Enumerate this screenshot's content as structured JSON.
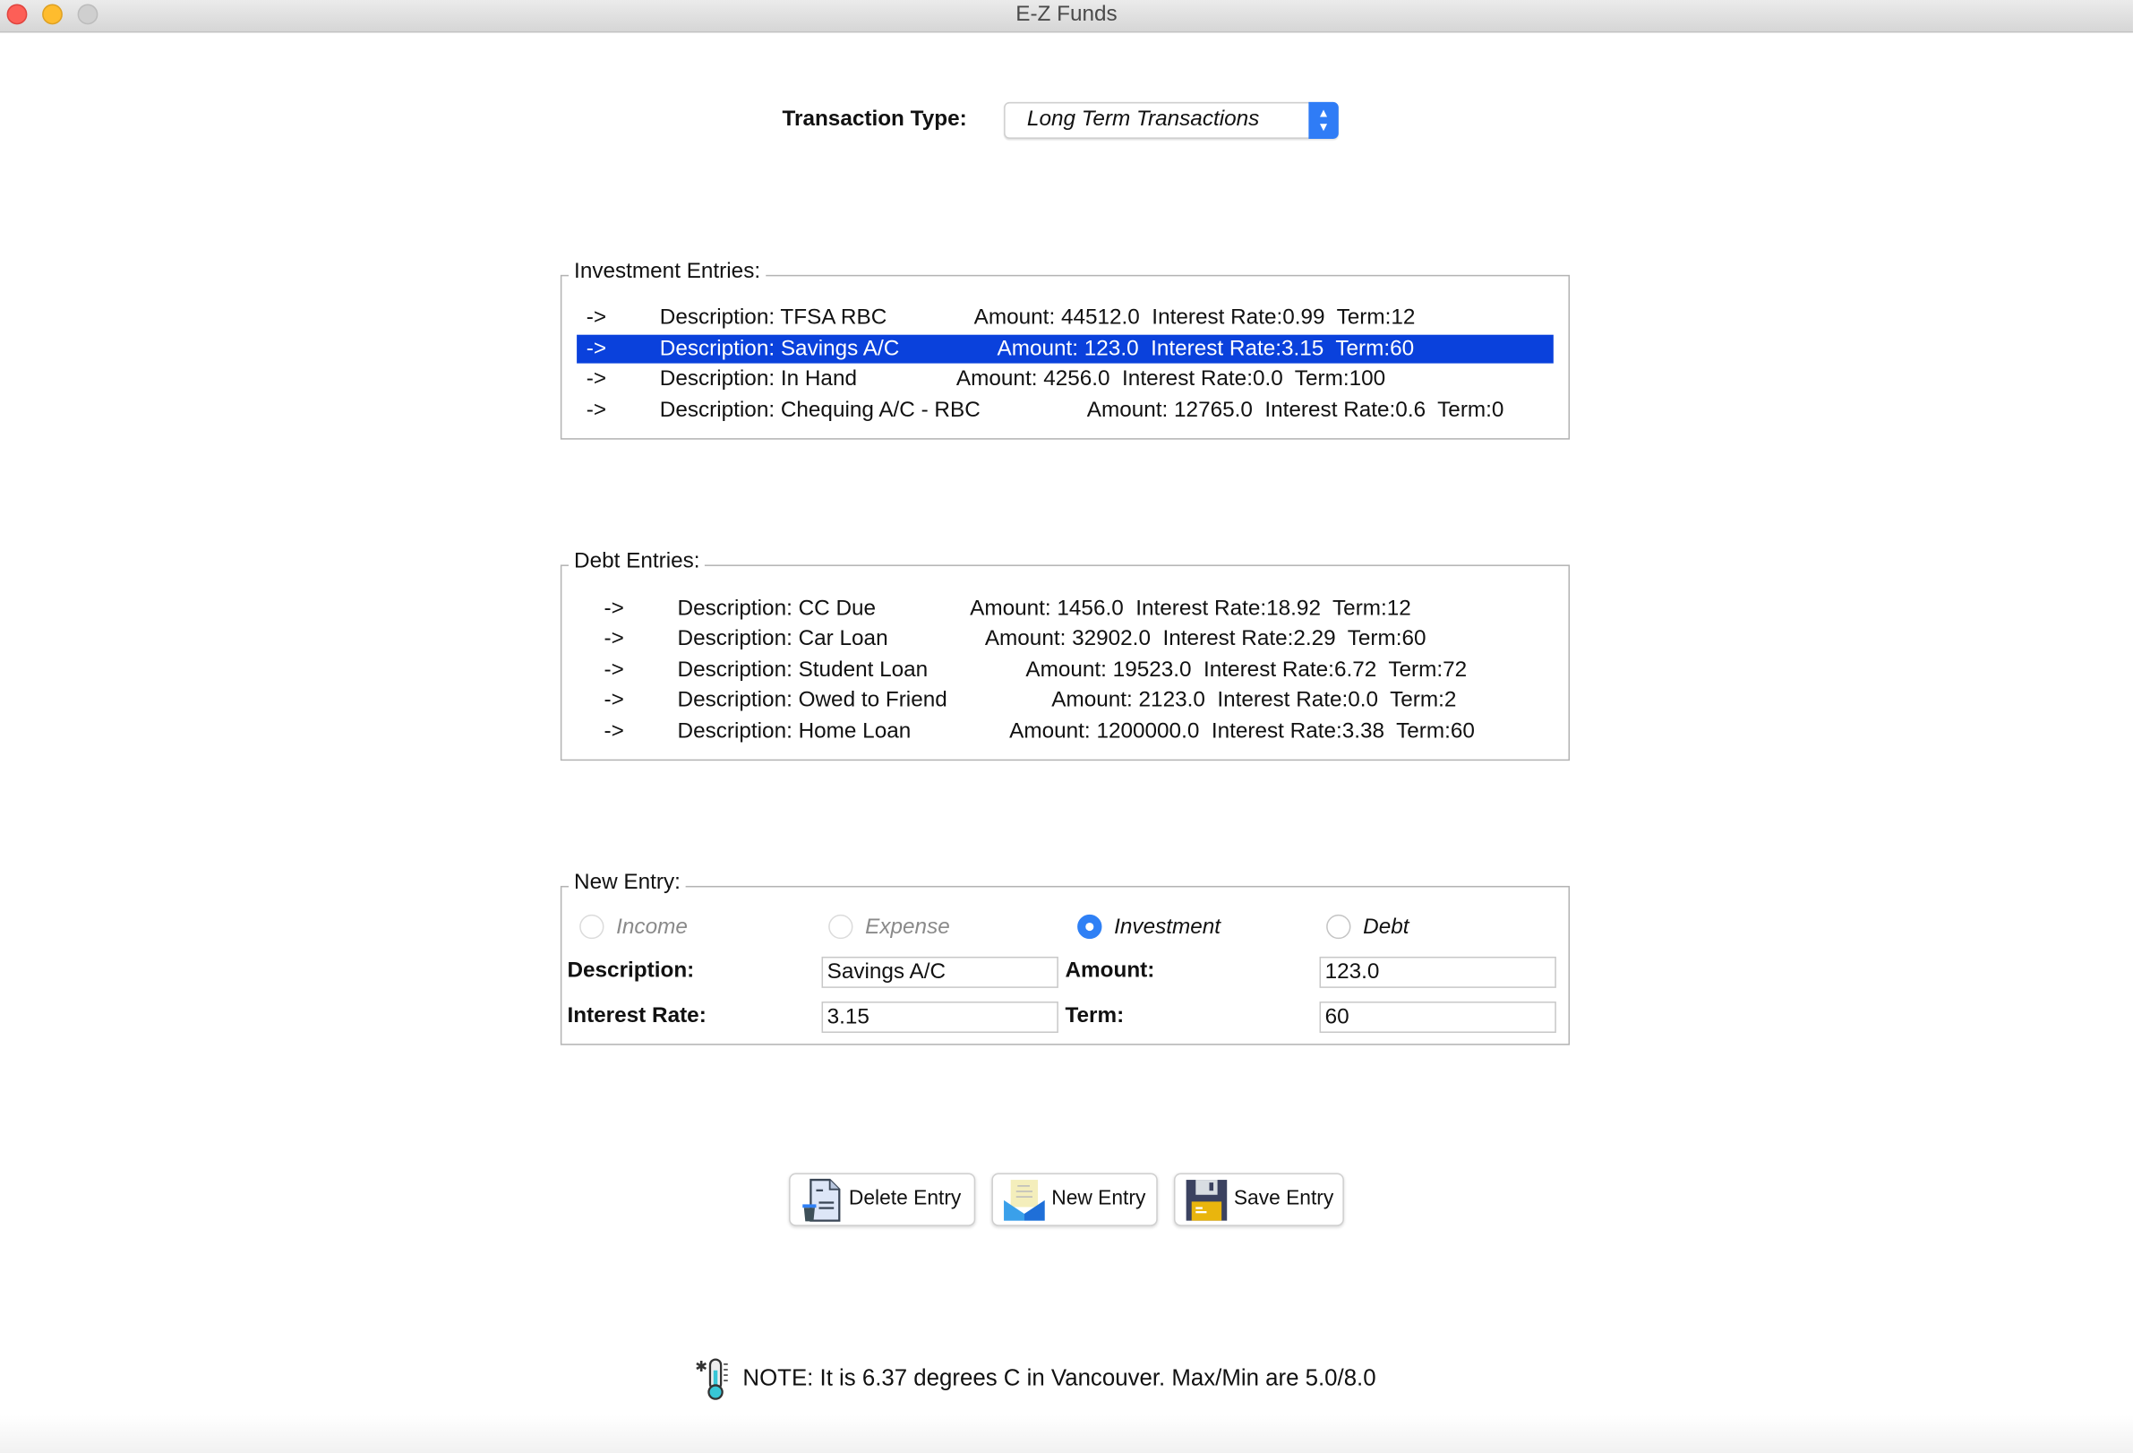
{
  "window": {
    "title": "E-Z Funds",
    "colors": {
      "close": "#fd5f57",
      "minimize": "#febc2e",
      "zoom": "#cfcfcf"
    }
  },
  "transaction_type": {
    "label": "Transaction Type:",
    "selected": "Long Term Transactions"
  },
  "investment": {
    "title": "Investment Entries:",
    "selected_index": 1,
    "selection_color": "#0a41dc",
    "rows": [
      {
        "arrow": "->",
        "description": "Description: TFSA RBC",
        "details": "Amount: 44512.0  Interest Rate:0.99  Term:12"
      },
      {
        "arrow": "->",
        "description": "Description: Savings A/C",
        "details": "Amount: 123.0  Interest Rate:3.15  Term:60"
      },
      {
        "arrow": "->",
        "description": "Description: In Hand",
        "details": "Amount: 4256.0  Interest Rate:0.0  Term:100"
      },
      {
        "arrow": "->",
        "description": "Description: Chequing A/C - RBC",
        "details": "Amount: 12765.0  Interest Rate:0.6  Term:0"
      }
    ]
  },
  "debt": {
    "title": "Debt Entries:",
    "rows": [
      {
        "arrow": "->",
        "description": "Description: CC Due",
        "details": "Amount: 1456.0  Interest Rate:18.92  Term:12"
      },
      {
        "arrow": "->",
        "description": "Description: Car Loan",
        "details": "Amount: 32902.0  Interest Rate:2.29  Term:60"
      },
      {
        "arrow": "->",
        "description": "Description: Student Loan",
        "details": "Amount: 19523.0  Interest Rate:6.72  Term:72"
      },
      {
        "arrow": "->",
        "description": "Description: Owed to Friend",
        "details": "Amount: 2123.0  Interest Rate:0.0  Term:2"
      },
      {
        "arrow": "->",
        "description": "Description: Home Loan",
        "details": "Amount: 1200000.0  Interest Rate:3.38  Term:60"
      }
    ]
  },
  "new_entry": {
    "title": "New Entry:",
    "radios": [
      {
        "label": "Income",
        "checked": false,
        "enabled": false
      },
      {
        "label": "Expense",
        "checked": false,
        "enabled": false
      },
      {
        "label": "Investment",
        "checked": true,
        "enabled": true
      },
      {
        "label": "Debt",
        "checked": false,
        "enabled": true
      }
    ],
    "description_label": "Description:",
    "description_value": "Savings A/C",
    "amount_label": "Amount:",
    "amount_value": "123.0",
    "interest_label": "Interest Rate:",
    "interest_value": "3.15",
    "term_label": "Term:",
    "term_value": "60"
  },
  "buttons": {
    "delete": "Delete Entry",
    "new": "New Entry",
    "save": "Save Entry"
  },
  "note": {
    "icon": "thermometer-icon",
    "text": "NOTE: It is 6.37 degrees C in Vancouver. Max/Min are 5.0/8.0"
  }
}
